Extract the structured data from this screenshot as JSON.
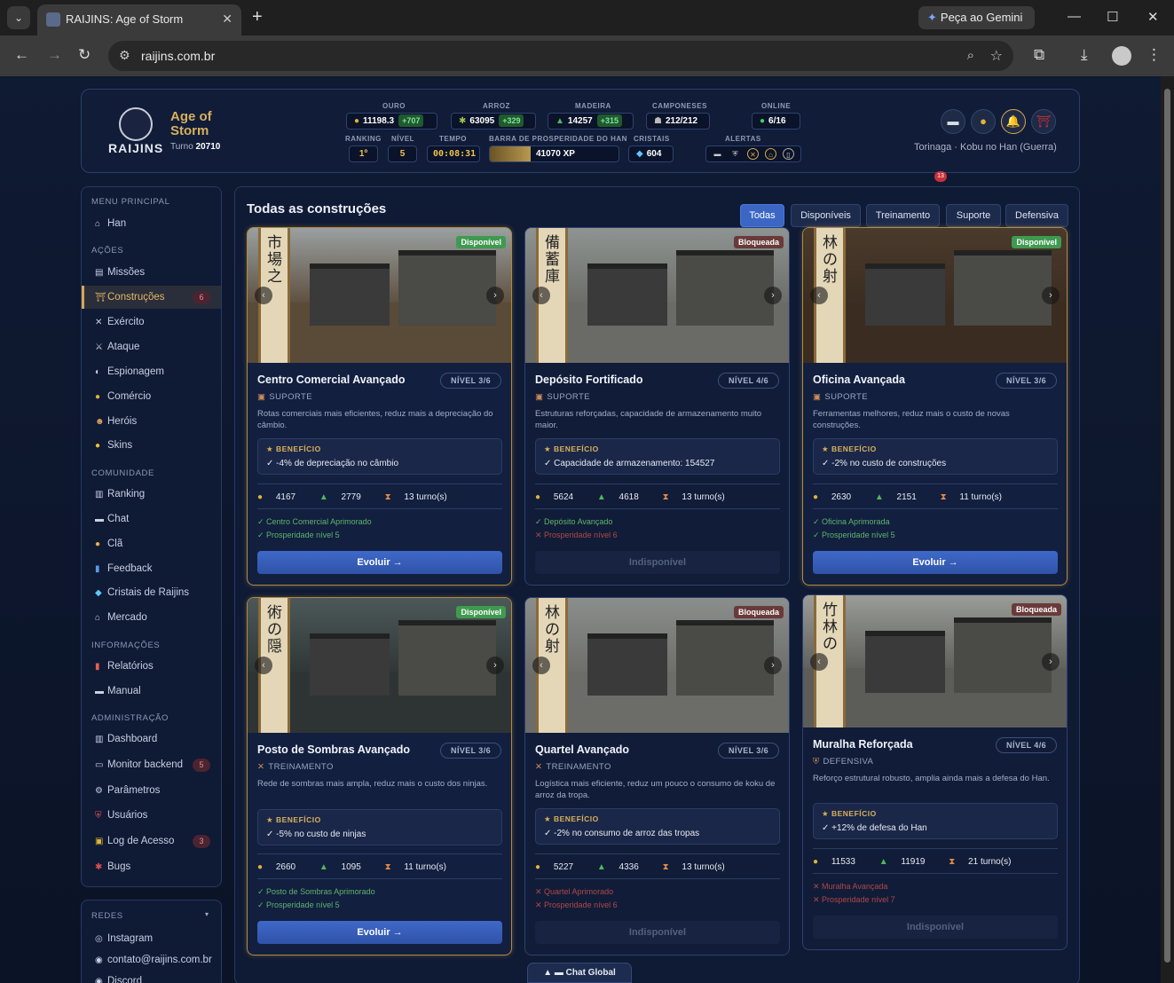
{
  "browser": {
    "tab_title": "RAIJINS: Age of Storm",
    "url": "raijins.com.br",
    "gemini_label": "Peça ao Gemini"
  },
  "header": {
    "brand": "RAIJINS",
    "subtitle_line1": "Age of",
    "subtitle_line2": "Storm",
    "turn_label": "Turno",
    "turn_value": "20710",
    "stats": {
      "ouro_label": "OURO",
      "ouro": "11198.3",
      "ouro_gain": "+707",
      "arroz_label": "ARROZ",
      "arroz": "63095",
      "arroz_gain": "+329",
      "madeira_label": "MADEIRA",
      "madeira": "14257",
      "madeira_gain": "+315",
      "camponeses_label": "CAMPONESES",
      "camponeses": "212/212",
      "online_label": "ONLINE",
      "online": "6/16",
      "ranking_label": "RANKING",
      "ranking": "1º",
      "nivel_label": "NÍVEL",
      "nivel": "5",
      "tempo_label": "TEMPO",
      "tempo": "00:08:31",
      "prosperidade_label": "BARRA DE PROSPERIDADE DO HAN",
      "prosperidade": "41070 XP",
      "prosperidade_fill": 0.32,
      "cristais_label": "CRISTAIS",
      "cristais": "604",
      "alertas_label": "ALERTAS"
    },
    "notif_count": "13",
    "user": "Torinaga · Kobu no Han (Guerra)"
  },
  "sidebar": {
    "sections": {
      "menu": "MENU PRINCIPAL",
      "acoes": "AÇÕES",
      "comunidade": "COMUNIDADE",
      "informacoes": "INFORMAÇÕES",
      "administracao": "ADMINISTRAÇÃO",
      "redes": "REDES"
    },
    "items": [
      {
        "label": "Han"
      },
      {
        "label": "Missões"
      },
      {
        "label": "Construções",
        "count": "6"
      },
      {
        "label": "Exército"
      },
      {
        "label": "Ataque"
      },
      {
        "label": "Espionagem"
      },
      {
        "label": "Comércio"
      },
      {
        "label": "Heróis"
      },
      {
        "label": "Skins"
      },
      {
        "label": "Ranking"
      },
      {
        "label": "Chat"
      },
      {
        "label": "Clã"
      },
      {
        "label": "Feedback"
      },
      {
        "label": "Cristais de Raijins"
      },
      {
        "label": "Mercado"
      },
      {
        "label": "Relatórios"
      },
      {
        "label": "Manual"
      },
      {
        "label": "Dashboard"
      },
      {
        "label": "Monitor backend",
        "count": "5"
      },
      {
        "label": "Parâmetros"
      },
      {
        "label": "Usuários"
      },
      {
        "label": "Log de Acesso",
        "count": "3"
      },
      {
        "label": "Bugs"
      }
    ],
    "redes": [
      {
        "label": "Instagram"
      },
      {
        "label": "contato@raijins.com.br"
      },
      {
        "label": "Discord"
      }
    ]
  },
  "main": {
    "title": "Todas as construções",
    "filters": [
      "Todas",
      "Disponíveis",
      "Treinamento",
      "Suporte",
      "Defensiva"
    ],
    "benefit_label": "★ BENEFÍCIO",
    "cards": [
      {
        "name": "Centro Comercial Avançado",
        "level": "NÍVEL 3/6",
        "status": "Disponível",
        "category": "SUPORTE",
        "desc": "Rotas comerciais mais eficientes, reduz mais a depreciação do câmbio.",
        "benefit": "✓ -4% de depreciação no câmbio",
        "gold": "4167",
        "wood": "2779",
        "turns": "13 turno(s)",
        "req1": "✓ Centro Comercial Aprimorado",
        "req2": "✓ Prosperidade nível 5",
        "button": "Evoluir →"
      },
      {
        "name": "Depósito Fortificado",
        "level": "NÍVEL 4/6",
        "status": "Bloqueada",
        "category": "SUPORTE",
        "desc": "Estruturas reforçadas, capacidade de armazenamento muito maior.",
        "benefit": "✓ Capacidade de armazenamento: 154527",
        "gold": "5624",
        "wood": "4618",
        "turns": "13 turno(s)",
        "req1": "✓ Depósito Avançado",
        "req2": "✕ Prosperidade nível 6",
        "button": "Indisponível"
      },
      {
        "name": "Oficina Avançada",
        "level": "NÍVEL 3/6",
        "status": "Disponível",
        "category": "SUPORTE",
        "desc": "Ferramentas melhores, reduz mais o custo de novas construções.",
        "benefit": "✓ -2% no custo de construções",
        "gold": "2630",
        "wood": "2151",
        "turns": "11 turno(s)",
        "req1": "✓ Oficina Aprimorada",
        "req2": "✓ Prosperidade nível 5",
        "button": "Evoluir →"
      },
      {
        "name": "Posto de Sombras Avançado",
        "level": "NÍVEL 3/6",
        "status": "Disponível",
        "category": "TREINAMENTO",
        "desc": "Rede de sombras mais ampla, reduz mais o custo dos ninjas.",
        "benefit": "✓ -5% no custo de ninjas",
        "gold": "2660",
        "wood": "1095",
        "turns": "11 turno(s)",
        "req1": "✓ Posto de Sombras Aprimorado",
        "req2": "✓ Prosperidade nível 5",
        "button": "Evoluir →"
      },
      {
        "name": "Quartel Avançado",
        "level": "NÍVEL 3/6",
        "status": "Bloqueada",
        "category": "TREINAMENTO",
        "desc": "Logística mais eficiente, reduz um pouco o consumo de koku de arroz da tropa.",
        "benefit": "✓ -2% no consumo de arroz das tropas",
        "gold": "5227",
        "wood": "4336",
        "turns": "13 turno(s)",
        "req1": "✕ Quartel Aprimorado",
        "req2": "✕ Prosperidade nível 6",
        "button": "Indisponível"
      },
      {
        "name": "Muralha Reforçada",
        "level": "NÍVEL 4/6",
        "status": "Bloqueada",
        "category": "DEFENSIVA",
        "desc": "Reforço estrutural robusto, amplia ainda mais a defesa do Han.",
        "benefit": "✓ +12% de defesa do Han",
        "gold": "11533",
        "wood": "11919",
        "turns": "21 turno(s)",
        "req1": "✕ Muralha Avançada",
        "req2": "✕ Prosperidade nível 7",
        "button": "Indisponível"
      }
    ]
  },
  "chat_global": "Chat Global",
  "colors": {
    "accent": "#3b66c4",
    "gold": "#d8b05c",
    "available": "#3f9a50"
  }
}
